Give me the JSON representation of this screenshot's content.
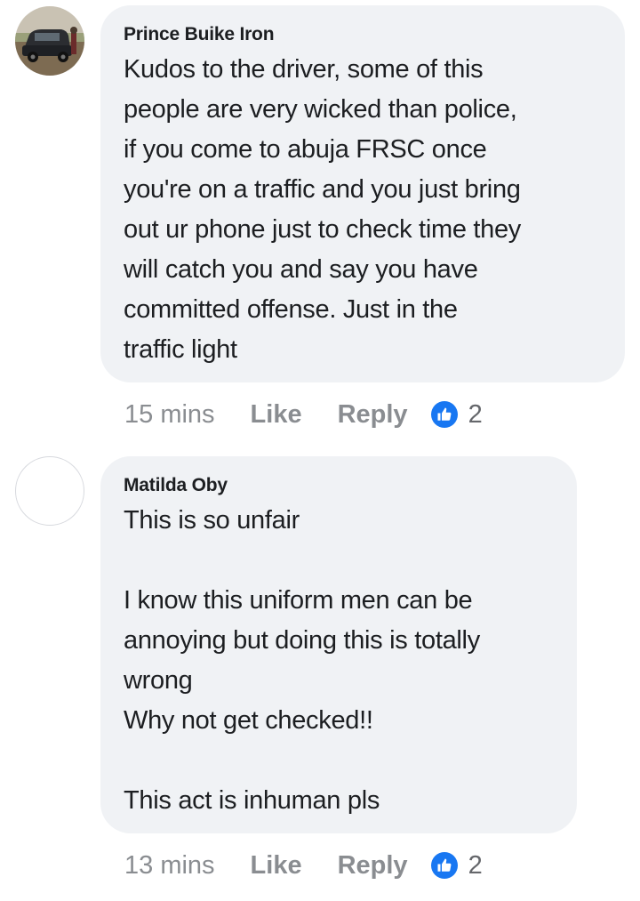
{
  "comments": [
    {
      "author": "Prince Buike Iron",
      "text": "Kudos to the driver, some of this\npeople are very wicked than police,\nif you come to abuja FRSC once\nyou're on a traffic and you just bring\nout ur phone just to check time they\nwill catch you and say you have\ncommitted offense. Just in the\ntraffic light",
      "time": "15 mins",
      "like_label": "Like",
      "reply_label": "Reply",
      "reaction_icon": "thumbs-up-icon",
      "reaction_count": "2",
      "avatar": "photo-car"
    },
    {
      "author": "Matilda Oby",
      "text": "This is so unfair\n\nI know this uniform men can be\nannoying but doing this is totally\nwrong\nWhy not get checked!!\n\nThis act is inhuman pls",
      "time": "13 mins",
      "like_label": "Like",
      "reply_label": "Reply",
      "reaction_icon": "thumbs-up-icon",
      "reaction_count": "2",
      "avatar": "empty"
    }
  ],
  "colors": {
    "bubble": "#f0f2f5",
    "text": "#1c1e21",
    "meta": "#8a8d91",
    "like_badge": "#1877f2"
  }
}
